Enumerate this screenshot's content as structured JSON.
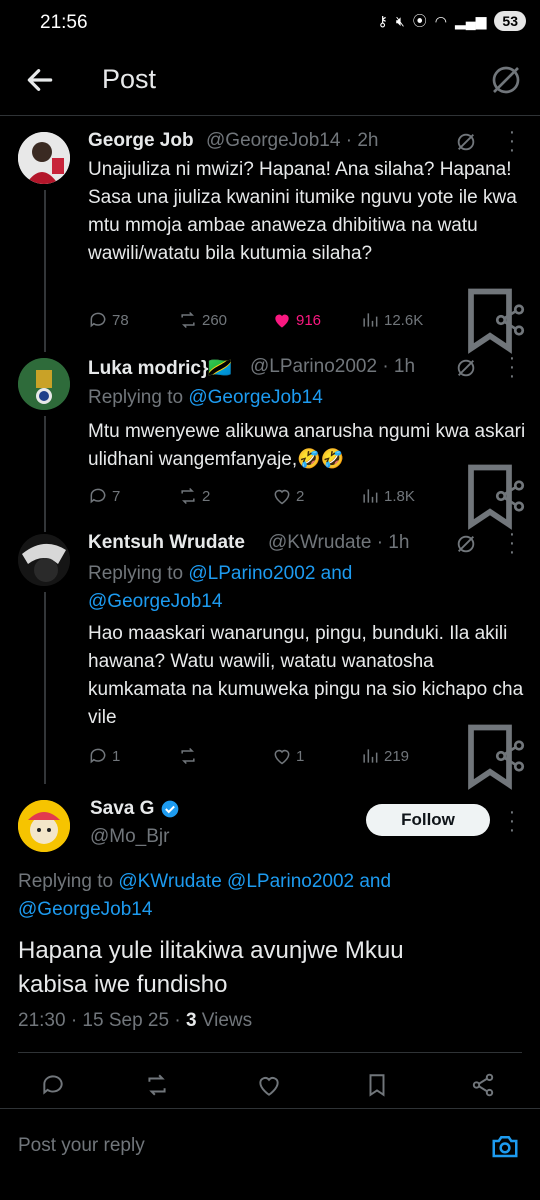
{
  "status": {
    "time": "21:56",
    "battery": "53"
  },
  "header": {
    "title": "Post"
  },
  "posts": [
    {
      "name": "George Job",
      "handle": "@GeorgeJob14 · 2h",
      "text": "Unajiuliza ni mwizi? Hapana! Ana silaha? Hapana! Sasa una jiuliza kwanini itumike nguvu yote ile kwa mtu mmoja ambae anaweza dhibitiwa na watu wawili/watatu bila kutumia silaha?",
      "replies": "78",
      "reposts": "260",
      "likes": "916",
      "views": "12.6K"
    },
    {
      "name": "Luka modric}🇹🇿",
      "handle": "@LParino2002 · 1h",
      "replying_prefix": "Replying to ",
      "replying_to": "@GeorgeJob14",
      "text": "Mtu mwenyewe alikuwa anarusha ngumi kwa askari ulidhani wangemfanyaje,🤣🤣",
      "replies": "7",
      "reposts": "2",
      "likes": "2",
      "views": "1.8K"
    },
    {
      "name": "Kentsuh Wrudate",
      "handle": "@KWrudate · 1h",
      "replying_prefix": "Replying to ",
      "replying_to": "@LParino2002 and @GeorgeJob14",
      "text": "Hao maaskari wanarungu, pingu, bunduki. Ila akili hawana? Watu wawili, watatu wanatosha kumkamata na kumuweka pingu na sio kichapo cha vile",
      "replies": "1",
      "reposts": "",
      "likes": "1",
      "views": "219"
    }
  ],
  "main": {
    "name": "Sava G",
    "handle": "@Mo_Bjr",
    "follow": "Follow",
    "replying_prefix": "Replying to ",
    "replying_to": "@KWrudate @LParino2002 and @GeorgeJob14",
    "text": "Hapana yule ilitakiwa avunjwe Mkuu kabisa iwe fundisho",
    "meta": "21:30 · 15 Sep 25 · ",
    "views_count": "3",
    "views_label": " Views"
  },
  "reply_bar": {
    "placeholder": "Post your reply"
  },
  "colors": {
    "accent": "#1d9bf0",
    "like": "#f91880",
    "muted": "#71767b",
    "bg": "#000000"
  }
}
